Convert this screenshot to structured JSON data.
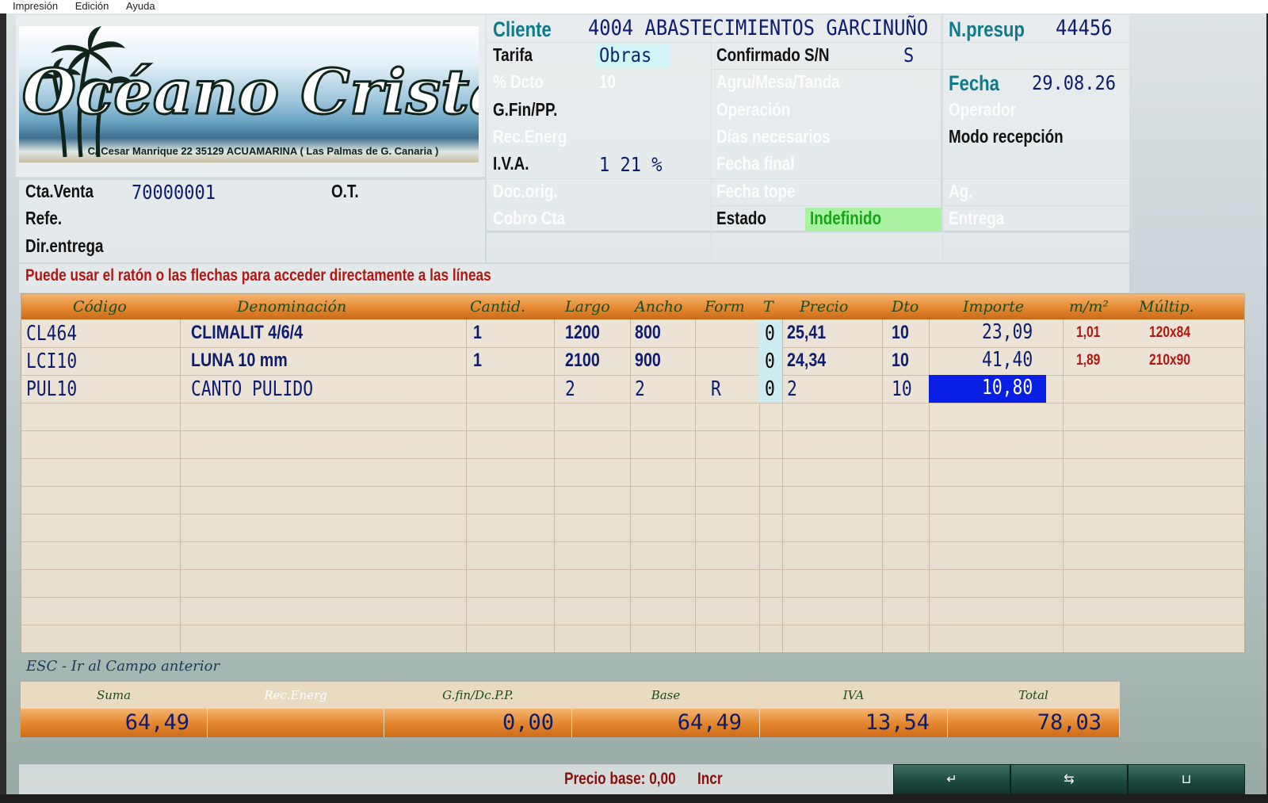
{
  "menu": {
    "items": [
      "Impresión",
      "Edición",
      "Ayuda"
    ]
  },
  "logo": {
    "brand": "Océano Cristal",
    "address": "C/ Cesar Manrique 22   35129 ACUAMARINA  ( Las Palmas de G. Canaria )"
  },
  "header": {
    "cliente_label": "Cliente",
    "cliente_value": "4004 ABASTECIMIENTOS GARCINUÑO",
    "npresup_label": "N.presup",
    "npresup_value": "44456",
    "tarifa_label": "Tarifa",
    "tarifa_value": "Obras",
    "dcto_label": "% Dcto",
    "dcto_value": "10",
    "gfin_label": "G.Fin/PP.",
    "recenerg_label": "Rec.Energ",
    "iva_label": "I.V.A.",
    "iva_value": "1 21 %",
    "confirmado_label": "Confirmado S/N",
    "confirmado_value": "S",
    "agru_label": "Agru/Mesa/Tanda",
    "operacion_label": "Operación",
    "dias_label": "Días necesarios",
    "fechafinal_label": "Fecha final",
    "fechatope_label": "Fecha tope",
    "estado_label": "Estado",
    "estado_value": "Indefinido",
    "fecha_label": "Fecha",
    "fecha_value": "29.08.26",
    "operador_label": "Operador",
    "modo_label": "Modo recepción",
    "ag_label": "Ag.",
    "entrega_label": "Entrega",
    "ctaventa_label": "Cta.Venta",
    "ctaventa_value": "70000001",
    "ot_label": "O.T.",
    "refe_label": "Refe.",
    "docorig_label": "Doc.orig.",
    "cobrocta_label": "Cobro Cta",
    "direntrega_label": "Dir.entrega",
    "hint": "Puede usar el ratón o las flechas para acceder directamente a las líneas"
  },
  "table": {
    "columns": [
      "Código",
      "Denominación",
      "Cantid.",
      "Largo",
      "Ancho",
      "Form",
      "T",
      "Precio",
      "Dto",
      "Importe",
      "m/m²",
      "Múltip."
    ],
    "rows": [
      {
        "codigo": "CL464",
        "denominacion": "CLIMALIT 4/6/4",
        "cantid": "1",
        "largo": "1200",
        "ancho": "800",
        "form": "",
        "t": "0",
        "precio": "25,41",
        "dto": "10",
        "importe": "23,09",
        "m2": "1,01",
        "multip": "120x84"
      },
      {
        "codigo": "LCI10",
        "denominacion": "LUNA 10 mm",
        "cantid": "1",
        "largo": "2100",
        "ancho": "900",
        "form": "",
        "t": "0",
        "precio": "24,34",
        "dto": "10",
        "importe": "41,40",
        "m2": "1,89",
        "multip": "210x90"
      },
      {
        "codigo": "PUL10",
        "denominacion": "CANTO PULIDO",
        "cantid": "",
        "largo": "2",
        "ancho": "2",
        "form": "R",
        "t": "0",
        "precio": "2",
        "dto": "10",
        "importe": "10,80",
        "m2": "",
        "multip": ""
      }
    ]
  },
  "esc_hint": "ESC - Ir al Campo anterior",
  "totals": {
    "labels": [
      "Suma",
      "Rec.Energ",
      "G.fin/Dc.P.P.",
      "Base",
      "IVA",
      "Total"
    ],
    "values": [
      "64,49",
      "",
      "0,00",
      "64,49",
      "13,54",
      "78,03"
    ]
  },
  "status": {
    "precio_base": "Precio base: 0,00",
    "incr": "Incr"
  },
  "buttons": [
    {
      "icon": "enter-icon",
      "glyph": "↵"
    },
    {
      "icon": "swap-icon",
      "glyph": "⇆"
    },
    {
      "icon": "basket-icon",
      "glyph": "⊔"
    }
  ]
}
